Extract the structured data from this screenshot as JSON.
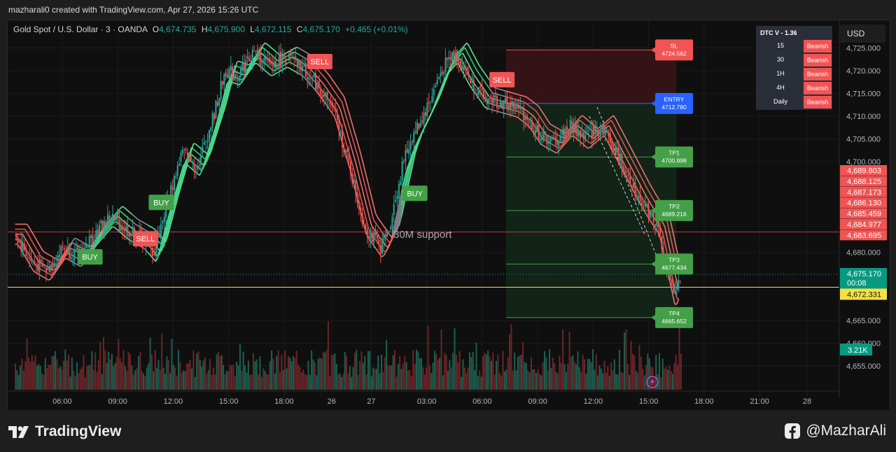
{
  "header": {
    "attribution": "mazharali0 created with TradingView.com, Apr 27, 2026 15:26 UTC"
  },
  "legend": {
    "symbol": "Gold Spot / U.S. Dollar · 3 · OANDA",
    "o_label": "O",
    "o_value": "4,674.735",
    "h_label": "H",
    "h_value": "4,675.900",
    "l_label": "L",
    "l_value": "4,672.115",
    "c_label": "C",
    "c_value": "4,675.170",
    "change": "+0.465 (+0.01%)"
  },
  "currency_button": "USD",
  "dtc_panel": {
    "title": "DTC V - 1.36",
    "rows": [
      {
        "tf": "15",
        "signal": "Bearish"
      },
      {
        "tf": "30",
        "signal": "Bearish"
      },
      {
        "tf": "1H",
        "signal": "Bearish"
      },
      {
        "tf": "4H",
        "signal": "Bearish"
      },
      {
        "tf": "Daily",
        "signal": "Bearish"
      }
    ]
  },
  "support_label": "30M support",
  "footer": {
    "brand": "TradingView",
    "social_handle": "@MazharAli"
  },
  "colors": {
    "bull": "#26a69a",
    "bear": "#ef5350",
    "buy": "#43a047",
    "sell": "#f05454",
    "entry": "#2962ff",
    "current_line": "#f0e060"
  },
  "chart_data": {
    "type": "candlestick",
    "symbol": "XAUUSD",
    "timeframe": "3",
    "ylim": [
      4651,
      4728
    ],
    "x_ticks": [
      {
        "t": 0.06,
        "label": "06:00"
      },
      {
        "t": 0.13,
        "label": "09:00"
      },
      {
        "t": 0.2,
        "label": "12:00"
      },
      {
        "t": 0.27,
        "label": "15:00"
      },
      {
        "t": 0.34,
        "label": "18:00"
      },
      {
        "t": 0.4,
        "label": "26"
      },
      {
        "t": 0.45,
        "label": "27"
      },
      {
        "t": 0.52,
        "label": "03:00"
      },
      {
        "t": 0.59,
        "label": "06:00"
      },
      {
        "t": 0.66,
        "label": "09:00"
      },
      {
        "t": 0.73,
        "label": "12:00"
      },
      {
        "t": 0.8,
        "label": "15:00"
      },
      {
        "t": 0.87,
        "label": "18:00"
      },
      {
        "t": 0.94,
        "label": "21:00"
      },
      {
        "t": 1.0,
        "label": "28"
      }
    ],
    "y_ticks": [
      {
        "v": 4725,
        "label": "4,725.000"
      },
      {
        "v": 4720,
        "label": "4,720.000"
      },
      {
        "v": 4715,
        "label": "4,715.000"
      },
      {
        "v": 4710,
        "label": "4,710.000"
      },
      {
        "v": 4705,
        "label": "4,705.000"
      },
      {
        "v": 4700,
        "label": "4,700.000"
      },
      {
        "v": 4680,
        "label": "4,680.000"
      },
      {
        "v": 4665,
        "label": "4,665.000"
      },
      {
        "v": 4660,
        "label": "4,660.000"
      },
      {
        "v": 4655,
        "label": "4,655.000"
      }
    ],
    "price_path": [
      [
        0.0,
        4684
      ],
      [
        0.02,
        4678
      ],
      [
        0.04,
        4676
      ],
      [
        0.06,
        4681
      ],
      [
        0.08,
        4679
      ],
      [
        0.1,
        4684
      ],
      [
        0.12,
        4688
      ],
      [
        0.14,
        4685
      ],
      [
        0.16,
        4683
      ],
      [
        0.175,
        4680
      ],
      [
        0.19,
        4690
      ],
      [
        0.21,
        4702
      ],
      [
        0.23,
        4699
      ],
      [
        0.25,
        4710
      ],
      [
        0.265,
        4720
      ],
      [
        0.28,
        4719
      ],
      [
        0.3,
        4724
      ],
      [
        0.32,
        4721
      ],
      [
        0.34,
        4723
      ],
      [
        0.36,
        4721
      ],
      [
        0.38,
        4717
      ],
      [
        0.4,
        4712
      ],
      [
        0.42,
        4700
      ],
      [
        0.44,
        4686
      ],
      [
        0.46,
        4681
      ],
      [
        0.47,
        4684
      ],
      [
        0.48,
        4692
      ],
      [
        0.49,
        4700
      ],
      [
        0.5,
        4705
      ],
      [
        0.52,
        4712
      ],
      [
        0.54,
        4721
      ],
      [
        0.555,
        4724
      ],
      [
        0.57,
        4719
      ],
      [
        0.59,
        4714
      ],
      [
        0.61,
        4713
      ],
      [
        0.63,
        4712
      ],
      [
        0.645,
        4710
      ],
      [
        0.66,
        4706
      ],
      [
        0.68,
        4704
      ],
      [
        0.7,
        4708
      ],
      [
        0.72,
        4705
      ],
      [
        0.74,
        4708
      ],
      [
        0.755,
        4703
      ],
      [
        0.77,
        4698
      ],
      [
        0.785,
        4693
      ],
      [
        0.795,
        4690
      ],
      [
        0.81,
        4686
      ],
      [
        0.82,
        4678
      ],
      [
        0.83,
        4670
      ],
      [
        0.84,
        4675.17
      ]
    ],
    "indicator_state": [
      {
        "t0": 0.0,
        "t1": 0.07,
        "state": "bear"
      },
      {
        "t0": 0.07,
        "t1": 0.09,
        "state": "neutral"
      },
      {
        "t0": 0.09,
        "t1": 0.15,
        "state": "bull"
      },
      {
        "t0": 0.15,
        "t1": 0.17,
        "state": "neutral"
      },
      {
        "t0": 0.17,
        "t1": 0.36,
        "state": "bull"
      },
      {
        "t0": 0.36,
        "t1": 0.38,
        "state": "neutral"
      },
      {
        "t0": 0.38,
        "t1": 0.48,
        "state": "bear"
      },
      {
        "t0": 0.48,
        "t1": 0.49,
        "state": "neutral"
      },
      {
        "t0": 0.49,
        "t1": 0.6,
        "state": "bull"
      },
      {
        "t0": 0.6,
        "t1": 0.62,
        "state": "neutral"
      },
      {
        "t0": 0.62,
        "t1": 0.84,
        "state": "bear"
      }
    ],
    "signals": [
      {
        "type": "BUY",
        "t": 0.095,
        "price": 4679
      },
      {
        "type": "SELL",
        "t": 0.165,
        "price": 4683
      },
      {
        "type": "BUY",
        "t": 0.185,
        "price": 4691
      },
      {
        "type": "SELL",
        "t": 0.385,
        "price": 4722
      },
      {
        "type": "BUY",
        "t": 0.505,
        "price": 4693
      },
      {
        "type": "SELL",
        "t": 0.615,
        "price": 4718
      }
    ],
    "trade_setup": {
      "t_start": 0.62,
      "t_end": 0.835,
      "sl": 4724.562,
      "entry": 4712.78,
      "tp1": 4700.998,
      "tp2": 4689.216,
      "tp3": 4677.434,
      "tp4": 4665.652,
      "labels": {
        "sl": [
          "SL",
          "4724.562"
        ],
        "entry": [
          "ENTRY",
          "4712.780"
        ],
        "tp1": [
          "TP1",
          "4700.998"
        ],
        "tp2": [
          "TP2",
          "4689.216"
        ],
        "tp3": [
          "TP3",
          "4677.434"
        ],
        "tp4": [
          "TP4",
          "4665.652"
        ]
      }
    },
    "support_level": 4684.5,
    "current_price": 4675.17,
    "current_price_label": "4,675.170",
    "countdown": "00:08",
    "yellow_level": 4672.331,
    "yellow_level_label": "4,672.331",
    "volume_label": "3.21K",
    "ma_labels": [
      {
        "v": 4689.803,
        "label": "4,689.803"
      },
      {
        "v": 4688.125,
        "label": "4,688.125"
      },
      {
        "v": 4687.173,
        "label": "4,687.173"
      },
      {
        "v": 4686.13,
        "label": "4,686.130"
      },
      {
        "v": 4685.459,
        "label": "4,685.459"
      },
      {
        "v": 4684.977,
        "label": "4,684.977"
      },
      {
        "v": 4683.695,
        "label": "4,683.695"
      }
    ]
  }
}
